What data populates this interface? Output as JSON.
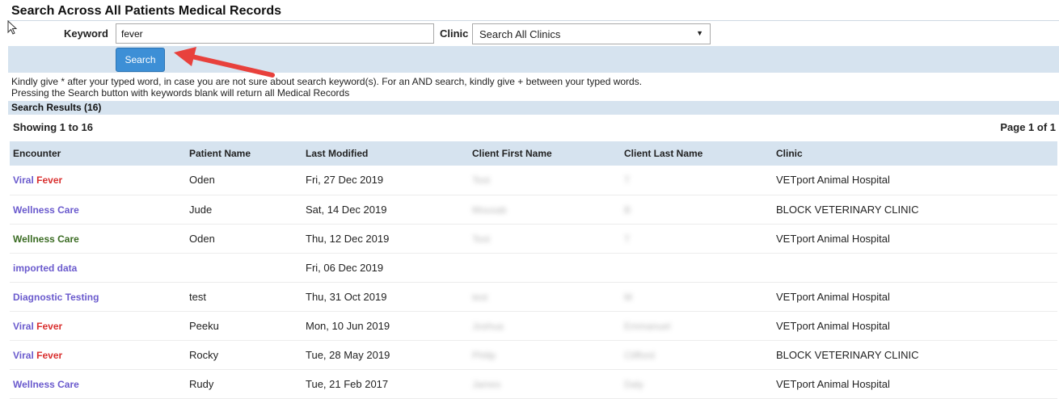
{
  "page": {
    "title": "Search Across All Patients Medical Records"
  },
  "search": {
    "keyword_label": "Keyword",
    "keyword_value": "fever",
    "clinic_label": "Clinic",
    "clinic_selected": "Search All Clinics",
    "button_label": "Search",
    "help_line1": "Kindly give * after your typed word, in case you are not sure about search keyword(s). For an AND search, kindly give + between your typed words.",
    "help_line2": "Pressing the Search button with keywords blank will return all Medical Records"
  },
  "results": {
    "bar_label": "Search Results  (16)",
    "showing": "Showing 1 to 16",
    "page_of": "Page 1 of 1",
    "columns": [
      "Encounter",
      "Patient Name",
      "Last Modified",
      "Client First Name",
      "Client Last Name",
      "Clinic"
    ],
    "rows": [
      {
        "encounter_a": "Viral ",
        "encounter_b": "Fever",
        "color_a": "#6a5acd",
        "color_b": "#d9302f",
        "patient": "Oden",
        "modified": "Fri, 27 Dec 2019",
        "first": "Test",
        "last": "T",
        "clinic": "VETport Animal Hospital"
      },
      {
        "encounter_a": "Wellness Care",
        "encounter_b": "",
        "color_a": "#6a5acd",
        "color_b": "#6a5acd",
        "patient": "Jude",
        "modified": "Sat, 14 Dec 2019",
        "first": "Mousab",
        "last": "B",
        "clinic": "BLOCK VETERINARY CLINIC"
      },
      {
        "encounter_a": "Wellness Care",
        "encounter_b": "",
        "color_a": "#3a6b22",
        "color_b": "#3a6b22",
        "patient": "Oden",
        "modified": "Thu, 12 Dec 2019",
        "first": "Test",
        "last": "T",
        "clinic": "VETport Animal Hospital"
      },
      {
        "encounter_a": "imported data",
        "encounter_b": "",
        "color_a": "#6a5acd",
        "color_b": "#6a5acd",
        "patient": "",
        "modified": "Fri, 06 Dec 2019",
        "first": "",
        "last": "",
        "clinic": ""
      },
      {
        "encounter_a": "Diagnostic Testing",
        "encounter_b": "",
        "color_a": "#6a5acd",
        "color_b": "#6a5acd",
        "patient": "test",
        "modified": "Thu, 31 Oct 2019",
        "first": "test",
        "last": "M",
        "clinic": "VETport Animal Hospital"
      },
      {
        "encounter_a": "Viral ",
        "encounter_b": "Fever",
        "color_a": "#6a5acd",
        "color_b": "#d9302f",
        "patient": "Peeku",
        "modified": "Mon, 10 Jun 2019",
        "first": "Joshua",
        "last": "Emmanuel",
        "clinic": "VETport Animal Hospital"
      },
      {
        "encounter_a": "Viral ",
        "encounter_b": "Fever",
        "color_a": "#6a5acd",
        "color_b": "#d9302f",
        "patient": "Rocky",
        "modified": "Tue, 28 May 2019",
        "first": "Philip",
        "last": "Clifford",
        "clinic": "BLOCK VETERINARY CLINIC"
      },
      {
        "encounter_a": "Wellness Care",
        "encounter_b": "",
        "color_a": "#6a5acd",
        "color_b": "#6a5acd",
        "patient": "Rudy",
        "modified": "Tue, 21 Feb 2017",
        "first": "James",
        "last": "Daly",
        "clinic": "VETport Animal Hospital"
      }
    ]
  },
  "colors": {
    "accent_bar": "#d6e3ef",
    "button": "#3d8fd6",
    "annotation_arrow": "#e8413c"
  },
  "icons": {
    "cursor": "mouse-pointer-icon",
    "dropdown": "chevron-down-icon",
    "annotation": "red-arrow-annotation"
  }
}
